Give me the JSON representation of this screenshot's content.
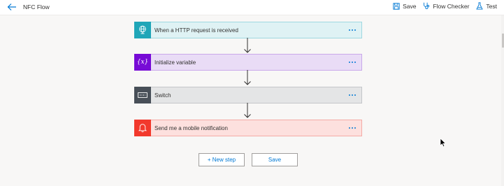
{
  "header": {
    "flow_name": "NFC Flow",
    "save_label": "Save",
    "flow_checker_label": "Flow Checker",
    "test_label": "Test"
  },
  "steps": [
    {
      "title": "When a HTTP request is received",
      "icon": "globe-request-icon",
      "accent": "#20a6b8"
    },
    {
      "title": "Initialize variable",
      "icon": "variable-icon",
      "icon_text": "{x}",
      "accent": "#770bd6"
    },
    {
      "title": "Switch",
      "icon": "switch-icon",
      "accent": "#484f58"
    },
    {
      "title": "Send me a mobile notification",
      "icon": "bell-icon",
      "accent": "#f2392c"
    }
  ],
  "footer": {
    "new_step_label": "+ New step",
    "save_label": "Save"
  },
  "colors": {
    "link_blue": "#0078d4",
    "canvas": "#f8f7f6"
  }
}
